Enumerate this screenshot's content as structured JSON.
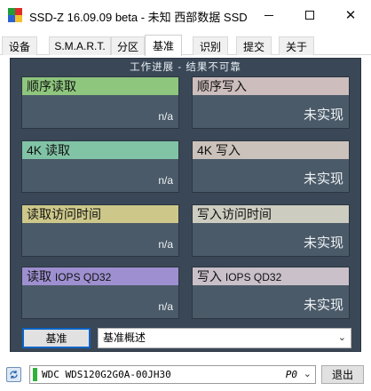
{
  "window": {
    "title": "SSD-Z 16.09.09 beta - 未知 西部数据 SSD",
    "minimize_glyph": "",
    "close_glyph": "✕"
  },
  "tabs": [
    {
      "label": "设备"
    },
    {
      "label": "S.M.A.R.T."
    },
    {
      "label": "分区"
    },
    {
      "label": "基准",
      "active": true
    },
    {
      "label": "识别"
    },
    {
      "label": "提交"
    },
    {
      "label": "关于"
    }
  ],
  "benchmark": {
    "caption": "工作进展 - 结果不可靠",
    "cards": [
      {
        "title": "顺序读取",
        "value": "n/a"
      },
      {
        "title": "顺序写入",
        "value": "未实现"
      },
      {
        "title": "4K 读取",
        "value": "n/a"
      },
      {
        "title": "4K 写入",
        "value": "未实现"
      },
      {
        "title": "读取访问时间",
        "value": "n/a"
      },
      {
        "title": "写入访问时间",
        "value": "未实现"
      },
      {
        "title_main": "读取",
        "title_small": "IOPS QD32",
        "value": "n/a"
      },
      {
        "title_main": "写入",
        "title_small": "IOPS QD32",
        "value": "未实现"
      }
    ],
    "run_button_label": "基准",
    "mode_select": {
      "value": "基准概述",
      "chevron": "⌄"
    }
  },
  "footer": {
    "refresh_icon": "refresh-icon",
    "drive": {
      "name": "WDC WDS120G2G0A-00JH30",
      "port": "P0",
      "chevron": "⌄"
    },
    "exit_label": "退出"
  },
  "colors": {
    "panel_bg": "#3a4756",
    "card_bg": "#4b5a68",
    "seq_read": "#8ec67e",
    "seq_write": "#cdbdbd",
    "k4_read": "#81c3a5",
    "k4_write": "#cbc2bb",
    "access_read": "#cdc88a",
    "access_write": "#ccccc0",
    "iops_read": "#9e90d0",
    "iops_write": "#c9c0c9",
    "status_green": "#2fb33b"
  }
}
